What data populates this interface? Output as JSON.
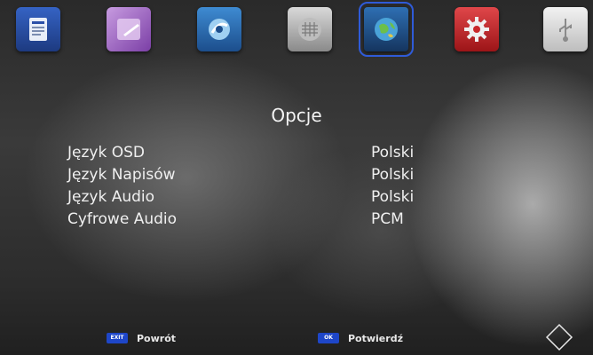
{
  "menu": {
    "icons": [
      {
        "name": "epg-icon",
        "color": "#2a4fa8"
      },
      {
        "name": "media-icon",
        "color": "#8c5ab0"
      },
      {
        "name": "satellite-icon",
        "color": "#3b7ec2"
      },
      {
        "name": "channel-list-icon",
        "color": "#9a9a9a"
      },
      {
        "name": "globe-icon",
        "color": "#3b8cc2"
      },
      {
        "name": "gear-icon",
        "color": "#c9282a"
      },
      {
        "name": "usb-icon",
        "color": "#d8d8d8"
      }
    ],
    "selected_index": 4
  },
  "title": "Opcje",
  "settings": [
    {
      "label": "Język OSD",
      "value": "Polski"
    },
    {
      "label": "Język Napisów",
      "value": "Polski"
    },
    {
      "label": "Język Audio",
      "value": "Polski"
    },
    {
      "label": "Cyfrowe Audio",
      "value": "PCM"
    }
  ],
  "footer": {
    "back": {
      "key": "EXIT",
      "label": "Powrót"
    },
    "confirm": {
      "key": "OK",
      "label": "Potwierdź"
    }
  }
}
